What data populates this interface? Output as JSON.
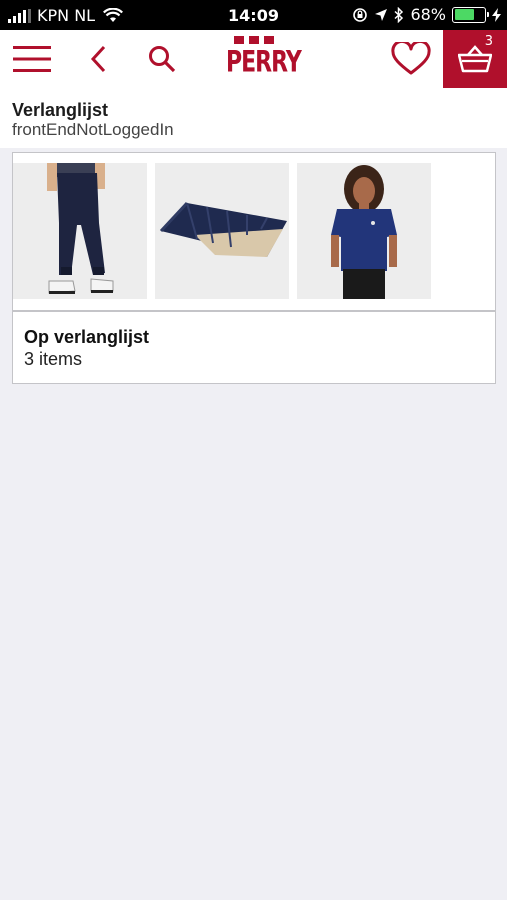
{
  "status_bar": {
    "carrier": "KPN NL",
    "time": "14:09",
    "battery": "68%",
    "battery_level": 0.68
  },
  "navbar": {
    "brand": "PERRY",
    "cart_count": "3",
    "accent_color": "#b0102c",
    "icons": [
      "menu-icon",
      "back-chevron-icon",
      "search-icon",
      "heart-icon",
      "basket-icon"
    ]
  },
  "header": {
    "title": "Verlanglijst",
    "subtitle": "frontEndNotLoggedIn"
  },
  "wishlist": {
    "name": "Op verlanglijst",
    "count": "3 items",
    "thumbnails": [
      "navy-jogging-pants",
      "navy-sleeping-bag",
      "navy-t-shirt"
    ]
  }
}
